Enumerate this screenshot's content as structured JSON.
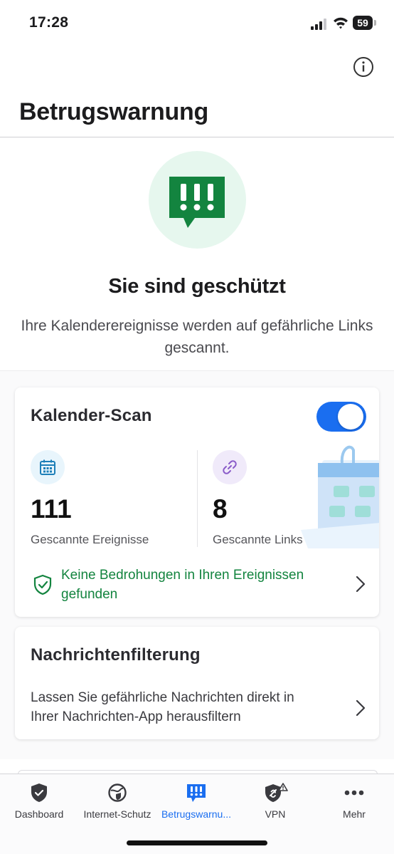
{
  "status_bar": {
    "time": "17:28",
    "battery": "59"
  },
  "header": {
    "title": "Betrugswarnung",
    "info_icon": "info-circle-icon"
  },
  "hero": {
    "icon": "alert-speech-bubble-icon",
    "title": "Sie sind geschützt",
    "description": "Ihre Kalenderereignisse werden auf gefährliche Links gescannt."
  },
  "calendar_scan": {
    "title": "Kalender-Scan",
    "toggle_on": true,
    "events": {
      "value": "111",
      "label": "Gescannte Ereignisse",
      "icon": "calendar-icon"
    },
    "links": {
      "value": "8",
      "label": "Gescannte Links",
      "icon": "link-icon"
    },
    "status_text": "Keine Bedrohungen in Ihren Ereignissen gefunden"
  },
  "message_filter": {
    "title": "Nachrichtenfilterung",
    "description": "Lassen Sie gefährliche Nachrichten direkt in Ihrer Nachrichten-App herausfiltern"
  },
  "tabs": [
    {
      "label": "Dashboard",
      "icon": "shield-check-icon"
    },
    {
      "label": "Internet-Schutz",
      "icon": "globe-shield-icon"
    },
    {
      "label": "Betrugswarnu...",
      "icon": "alert-bubble-icon",
      "active": true
    },
    {
      "label": "VPN",
      "icon": "vpn-shield-warning-icon"
    },
    {
      "label": "Mehr",
      "icon": "more-dots-icon"
    }
  ],
  "colors": {
    "accent": "#1a6ef0",
    "brand_green": "#13843f",
    "hero_bg": "#e6f7ee"
  }
}
